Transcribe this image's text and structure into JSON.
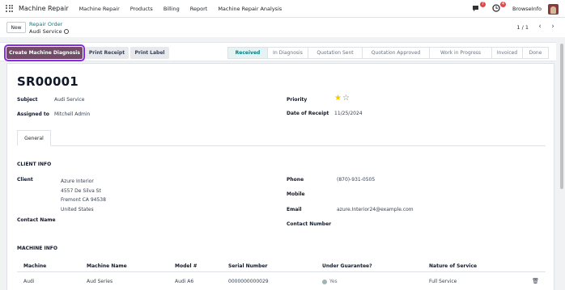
{
  "navbar": {
    "brand": "Machine Repair",
    "menu": [
      "Machine Repair",
      "Products",
      "Billing",
      "Report",
      "Machine Repair Analysis"
    ],
    "chat_badge": "7",
    "activity_badge": "4",
    "company": "BrowseInfo"
  },
  "control": {
    "new_label": "New",
    "breadcrumb_parent": "Repair Order",
    "breadcrumb_current": "Audi Service",
    "pager": "1 / 1"
  },
  "actions": {
    "primary": "Create Machine Diagnosis",
    "print_receipt": "Print Receipt",
    "print_label": "Print Label"
  },
  "stages": [
    "Received",
    "In Diagnosis",
    "Quotation Sent",
    "Quotation Approved",
    "Work in Progress",
    "Invoiced",
    "Done"
  ],
  "active_stage": "Received",
  "form": {
    "reference": "SR00001",
    "subject_label": "Subject",
    "subject": "Audi Service",
    "assigned_label": "Assigned to",
    "assigned": "Mitchell Admin",
    "priority_label": "Priority",
    "priority_stars": 1,
    "receipt_label": "Date of Receipt",
    "receipt_date": "11/25/2024",
    "tab": "General",
    "client_info_title": "CLIENT INFO",
    "client_label": "Client",
    "client_name": "Azure Interior",
    "client_street": "4557 De Silva St",
    "client_city": "Fremont CA 94538",
    "client_country": "United States",
    "contact_name_label": "Contact Name",
    "phone_label": "Phone",
    "phone": "(870)-931-0505",
    "mobile_label": "Mobile",
    "email_label": "Email",
    "email": "azure.Interior24@example.com",
    "contact_number_label": "Contact Number",
    "machine_info_title": "MACHINE INFO"
  },
  "table": {
    "headers": [
      "Machine",
      "Machine Name",
      "Model #",
      "Serial Number",
      "Under Guarantee?",
      "Nature of Service"
    ],
    "row": {
      "machine": "Audi",
      "machine_name": "Aud Series",
      "model": "Audi A6",
      "serial": "0000000000029",
      "guarantee": "Yes",
      "service": "Full Service"
    }
  },
  "colors": {
    "primary": "#714b67",
    "accent": "#017e84",
    "badge": "#e2474b",
    "star": "#f3cc00"
  }
}
